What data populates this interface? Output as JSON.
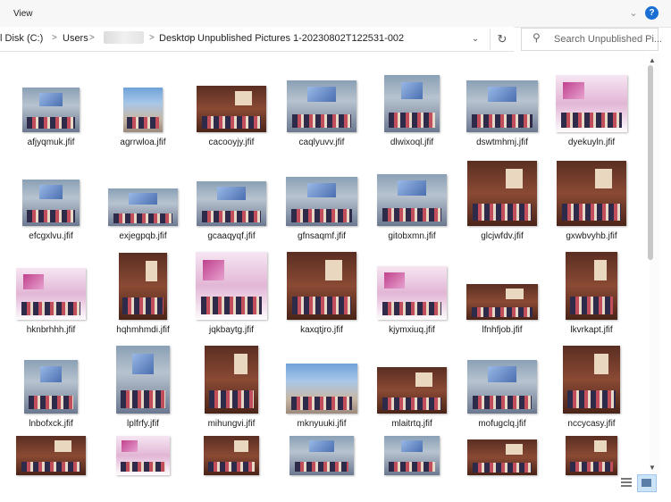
{
  "ribbon": {
    "view_label": "View",
    "help_label": "?"
  },
  "address_bar": {
    "segments": [
      "l Disk (C:)",
      "Users",
      "Desktop",
      "Unpublished Pictures 1-20230802T122531-002"
    ],
    "separator": ">"
  },
  "search": {
    "placeholder": "Search Unpublished Pi..."
  },
  "files": [
    "afjyqmuk.jfif",
    "agrrwloa.jfif",
    "cacooyjy.jfif",
    "caqlyuvv.jfif",
    "dlwixoql.jfif",
    "dswtmhmj.jfif",
    "dyekuyln.jfif",
    "efcgxlvu.jfif",
    "exjegpqb.jfif",
    "gcaaqyqf.jfif",
    "gfnsaqmf.jfif",
    "gitobxmn.jfif",
    "glcjwfdv.jfif",
    "gxwbvyhb.jfif",
    "hknbrhhh.jfif",
    "hqhmhmdi.jfif",
    "jqkbaytg.jfif",
    "kaxqtjro.jfif",
    "kjymxiuq.jfif",
    "lfnhfjob.jfif",
    "lkvrkapt.jfif",
    "lnbofxck.jfif",
    "lplfrfy.jfif",
    "mihungvi.jfif",
    "mknyuuki.jfif",
    "mlaitrtq.jfif",
    "mofugclq.jfif",
    "nccycasy.jfif",
    "",
    "",
    "",
    "",
    "",
    "",
    ""
  ]
}
